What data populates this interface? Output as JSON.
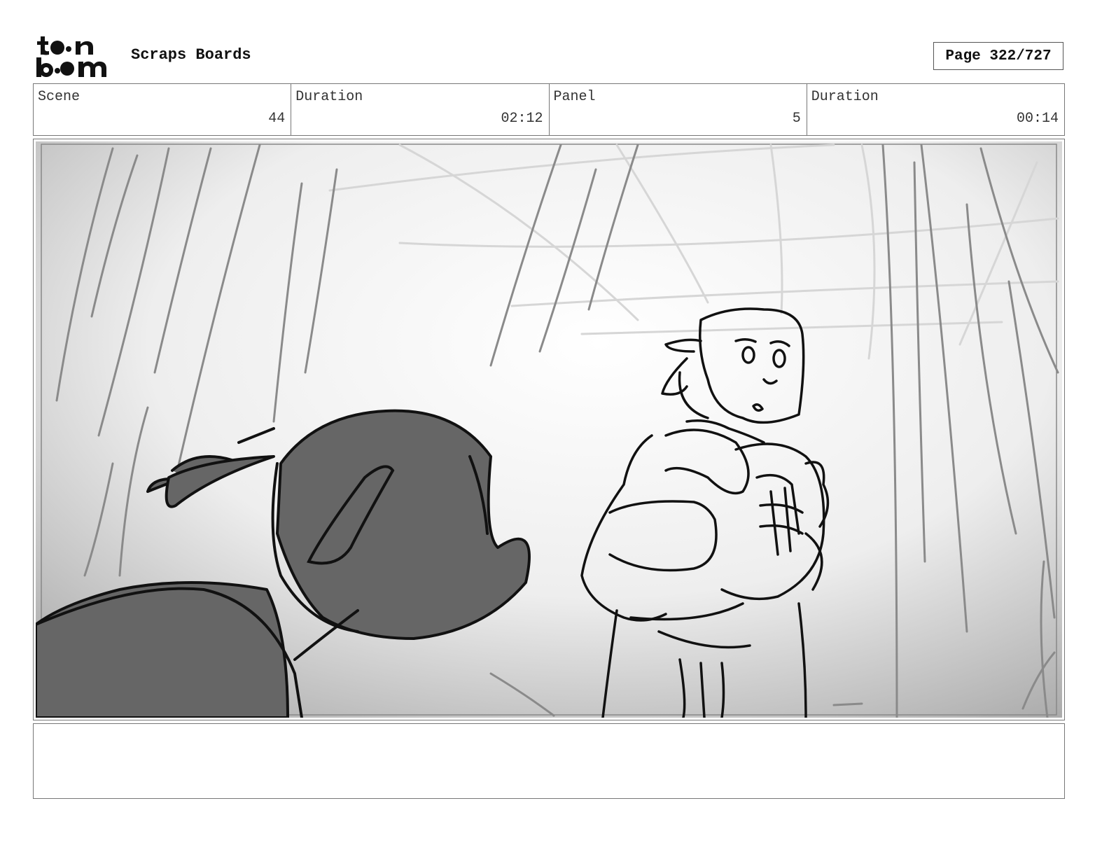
{
  "header": {
    "logo_text": "toon boom",
    "app_title": "Scraps Boards",
    "page_label": "Page 322/727"
  },
  "info": {
    "scene_label": "Scene",
    "scene_value": "44",
    "scene_duration_label": "Duration",
    "scene_duration_value": "02:12",
    "panel_label": "Panel",
    "panel_value": "5",
    "panel_duration_label": "Duration",
    "panel_duration_value": "00:14"
  },
  "notes": {
    "text": ""
  }
}
